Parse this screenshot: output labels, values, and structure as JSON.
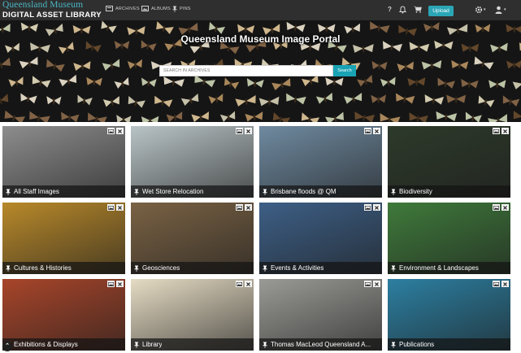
{
  "header": {
    "logo_line1": "Queensland Museum",
    "logo_line2": "DIGITAL ASSET LIBRARY",
    "nav": [
      {
        "label": "ARCHIVES",
        "icon": "archive-icon"
      },
      {
        "label": "ALBUMS",
        "icon": "albums-icon"
      },
      {
        "label": "PINS",
        "icon": "pin-icon"
      }
    ],
    "upload_label": "Upload"
  },
  "hero": {
    "title": "Queensland Museum Image Portal",
    "search_placeholder": "SEARCH IN ARCHIVES",
    "search_button": "Search"
  },
  "tiles": [
    {
      "label": "All Staff Images",
      "color": "#8d8d8d"
    },
    {
      "label": "Wet Store Relocation",
      "color": "#b9c4c6"
    },
    {
      "label": "Brisbane floods @ QM",
      "color": "#6f8aa0"
    },
    {
      "label": "Biodiversity",
      "color": "#2d3a2a"
    },
    {
      "label": "Cultures & Histories",
      "color": "#b8892a"
    },
    {
      "label": "Geosciences",
      "color": "#7a6244"
    },
    {
      "label": "Events & Activities",
      "color": "#3d5f86"
    },
    {
      "label": "Environment & Landscapes",
      "color": "#3f7a3b"
    },
    {
      "label": "Exhibitions & Displays",
      "color": "#a8452a"
    },
    {
      "label": "Library",
      "color": "#e6dcc4"
    },
    {
      "label": "Thomas MacLeod Queensland A...",
      "color": "#9a9a96"
    },
    {
      "label": "Publications",
      "color": "#2c7fa1"
    }
  ]
}
